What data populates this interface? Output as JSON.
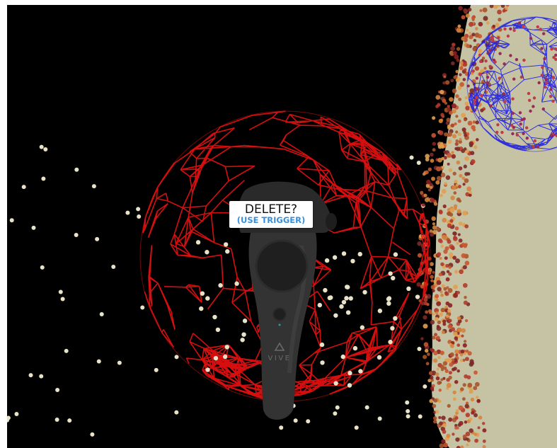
{
  "scene": {
    "type": "vr-viewport",
    "background_color": "#000000",
    "selected_sphere_color": "#e01010",
    "other_sphere_color": "#2020e0",
    "point_color": "#e8e2c8",
    "surface_color": "#c6c3a4"
  },
  "tooltip": {
    "title": "DELETE?",
    "hint": "(USE TRIGGER)",
    "hint_color": "#3a8fd8"
  },
  "controller": {
    "brand": "VIVE",
    "icons": [
      "trackpad-icon",
      "menu-button-icon",
      "vive-logo-icon",
      "trigger-icon"
    ]
  }
}
